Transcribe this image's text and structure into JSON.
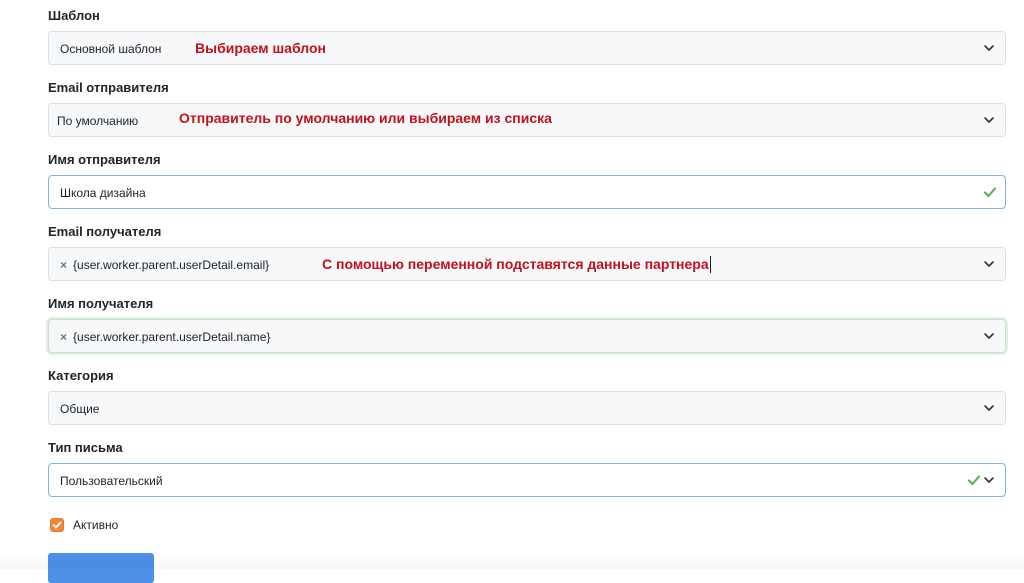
{
  "form": {
    "template": {
      "label": "Шаблон",
      "value": "Основной шаблон",
      "annotation": "Выбираем шаблон"
    },
    "sender_email": {
      "label": "Email отправителя",
      "value": "По умолчанию",
      "annotation": "Отправитель по умолчанию или выбираем из списка"
    },
    "sender_name": {
      "label": "Имя отправителя",
      "value": "Школа дизайна",
      "status": "valid"
    },
    "recipient_email": {
      "label": "Email получателя",
      "tag": "{user.worker.parent.userDetail.email}",
      "annotation": "С помощью переменной подставятся данные партнера"
    },
    "recipient_name": {
      "label": "Имя получателя",
      "tag": "{user.worker.parent.userDetail.name}"
    },
    "category": {
      "label": "Категория",
      "value": "Общие"
    },
    "letter_type": {
      "label": "Тип письма",
      "value": "Пользовательский",
      "status": "valid"
    },
    "active": {
      "label": "Активно",
      "checked": true
    },
    "submit": {
      "label": ""
    }
  },
  "icons": {
    "remove_tag": "×",
    "dropdown": "chevron-down-icon",
    "valid": "check-icon"
  },
  "colors": {
    "annotation": "#c0121c",
    "valid_check": "#4caf50",
    "checkbox": "#f0883a",
    "primary_button": "#4e8fe8"
  }
}
